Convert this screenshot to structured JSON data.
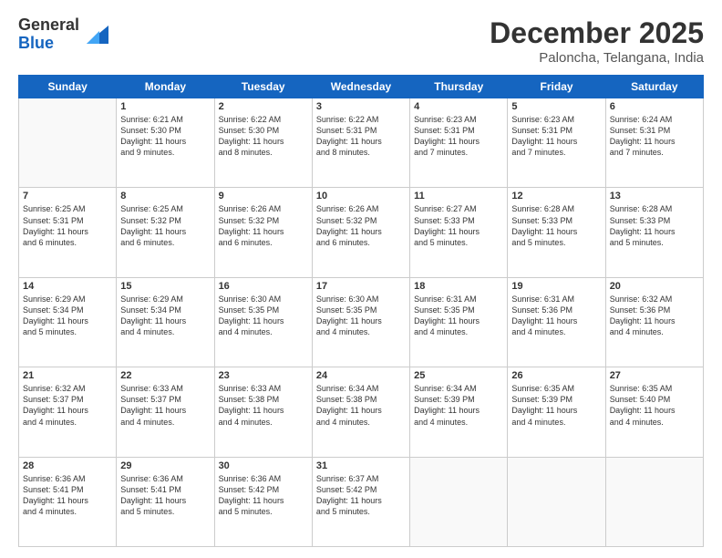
{
  "logo": {
    "general": "General",
    "blue": "Blue"
  },
  "header": {
    "month": "December 2025",
    "location": "Paloncha, Telangana, India"
  },
  "days": [
    "Sunday",
    "Monday",
    "Tuesday",
    "Wednesday",
    "Thursday",
    "Friday",
    "Saturday"
  ],
  "weeks": [
    [
      {
        "day": "",
        "content": ""
      },
      {
        "day": "1",
        "content": "Sunrise: 6:21 AM\nSunset: 5:30 PM\nDaylight: 11 hours\nand 9 minutes."
      },
      {
        "day": "2",
        "content": "Sunrise: 6:22 AM\nSunset: 5:30 PM\nDaylight: 11 hours\nand 8 minutes."
      },
      {
        "day": "3",
        "content": "Sunrise: 6:22 AM\nSunset: 5:31 PM\nDaylight: 11 hours\nand 8 minutes."
      },
      {
        "day": "4",
        "content": "Sunrise: 6:23 AM\nSunset: 5:31 PM\nDaylight: 11 hours\nand 7 minutes."
      },
      {
        "day": "5",
        "content": "Sunrise: 6:23 AM\nSunset: 5:31 PM\nDaylight: 11 hours\nand 7 minutes."
      },
      {
        "day": "6",
        "content": "Sunrise: 6:24 AM\nSunset: 5:31 PM\nDaylight: 11 hours\nand 7 minutes."
      }
    ],
    [
      {
        "day": "7",
        "content": "Sunrise: 6:25 AM\nSunset: 5:31 PM\nDaylight: 11 hours\nand 6 minutes."
      },
      {
        "day": "8",
        "content": "Sunrise: 6:25 AM\nSunset: 5:32 PM\nDaylight: 11 hours\nand 6 minutes."
      },
      {
        "day": "9",
        "content": "Sunrise: 6:26 AM\nSunset: 5:32 PM\nDaylight: 11 hours\nand 6 minutes."
      },
      {
        "day": "10",
        "content": "Sunrise: 6:26 AM\nSunset: 5:32 PM\nDaylight: 11 hours\nand 6 minutes."
      },
      {
        "day": "11",
        "content": "Sunrise: 6:27 AM\nSunset: 5:33 PM\nDaylight: 11 hours\nand 5 minutes."
      },
      {
        "day": "12",
        "content": "Sunrise: 6:28 AM\nSunset: 5:33 PM\nDaylight: 11 hours\nand 5 minutes."
      },
      {
        "day": "13",
        "content": "Sunrise: 6:28 AM\nSunset: 5:33 PM\nDaylight: 11 hours\nand 5 minutes."
      }
    ],
    [
      {
        "day": "14",
        "content": "Sunrise: 6:29 AM\nSunset: 5:34 PM\nDaylight: 11 hours\nand 5 minutes."
      },
      {
        "day": "15",
        "content": "Sunrise: 6:29 AM\nSunset: 5:34 PM\nDaylight: 11 hours\nand 4 minutes."
      },
      {
        "day": "16",
        "content": "Sunrise: 6:30 AM\nSunset: 5:35 PM\nDaylight: 11 hours\nand 4 minutes."
      },
      {
        "day": "17",
        "content": "Sunrise: 6:30 AM\nSunset: 5:35 PM\nDaylight: 11 hours\nand 4 minutes."
      },
      {
        "day": "18",
        "content": "Sunrise: 6:31 AM\nSunset: 5:35 PM\nDaylight: 11 hours\nand 4 minutes."
      },
      {
        "day": "19",
        "content": "Sunrise: 6:31 AM\nSunset: 5:36 PM\nDaylight: 11 hours\nand 4 minutes."
      },
      {
        "day": "20",
        "content": "Sunrise: 6:32 AM\nSunset: 5:36 PM\nDaylight: 11 hours\nand 4 minutes."
      }
    ],
    [
      {
        "day": "21",
        "content": "Sunrise: 6:32 AM\nSunset: 5:37 PM\nDaylight: 11 hours\nand 4 minutes."
      },
      {
        "day": "22",
        "content": "Sunrise: 6:33 AM\nSunset: 5:37 PM\nDaylight: 11 hours\nand 4 minutes."
      },
      {
        "day": "23",
        "content": "Sunrise: 6:33 AM\nSunset: 5:38 PM\nDaylight: 11 hours\nand 4 minutes."
      },
      {
        "day": "24",
        "content": "Sunrise: 6:34 AM\nSunset: 5:38 PM\nDaylight: 11 hours\nand 4 minutes."
      },
      {
        "day": "25",
        "content": "Sunrise: 6:34 AM\nSunset: 5:39 PM\nDaylight: 11 hours\nand 4 minutes."
      },
      {
        "day": "26",
        "content": "Sunrise: 6:35 AM\nSunset: 5:39 PM\nDaylight: 11 hours\nand 4 minutes."
      },
      {
        "day": "27",
        "content": "Sunrise: 6:35 AM\nSunset: 5:40 PM\nDaylight: 11 hours\nand 4 minutes."
      }
    ],
    [
      {
        "day": "28",
        "content": "Sunrise: 6:36 AM\nSunset: 5:41 PM\nDaylight: 11 hours\nand 4 minutes."
      },
      {
        "day": "29",
        "content": "Sunrise: 6:36 AM\nSunset: 5:41 PM\nDaylight: 11 hours\nand 5 minutes."
      },
      {
        "day": "30",
        "content": "Sunrise: 6:36 AM\nSunset: 5:42 PM\nDaylight: 11 hours\nand 5 minutes."
      },
      {
        "day": "31",
        "content": "Sunrise: 6:37 AM\nSunset: 5:42 PM\nDaylight: 11 hours\nand 5 minutes."
      },
      {
        "day": "",
        "content": ""
      },
      {
        "day": "",
        "content": ""
      },
      {
        "day": "",
        "content": ""
      }
    ]
  ]
}
